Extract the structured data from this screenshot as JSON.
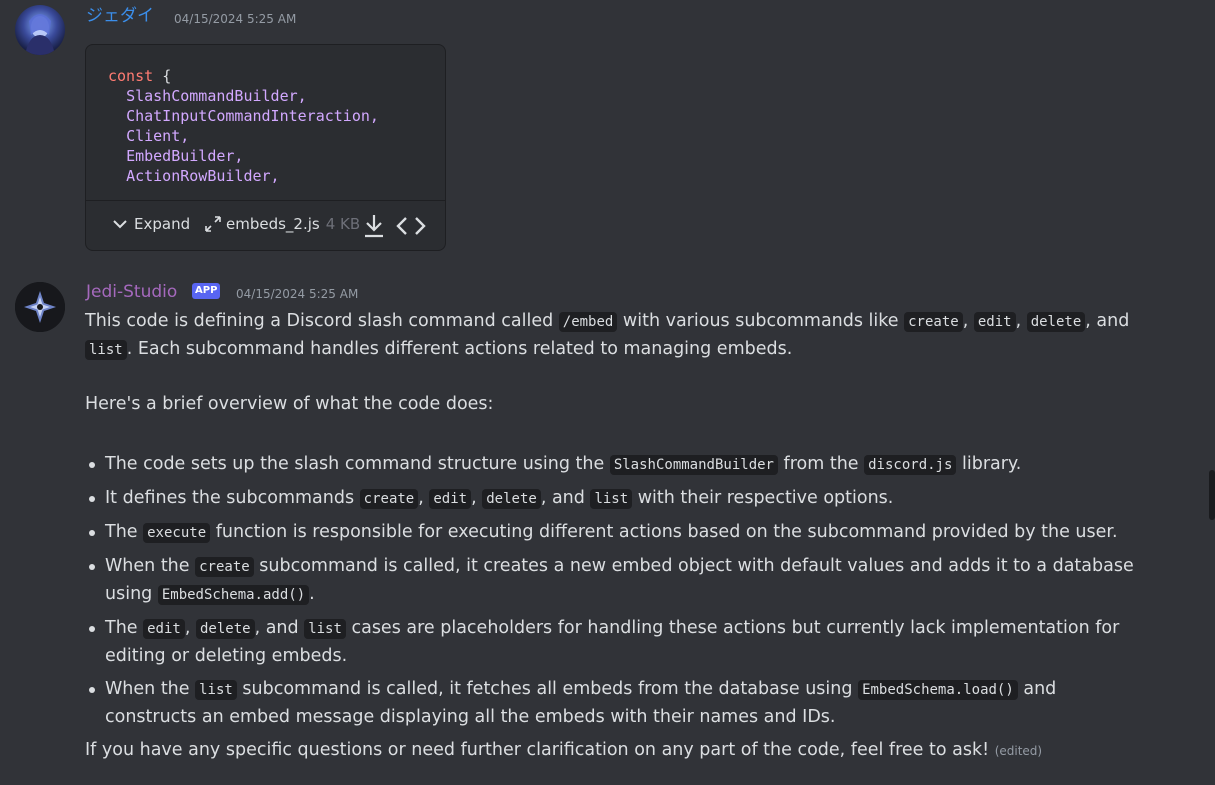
{
  "message1": {
    "username": "ジェダイ",
    "username_color": "#3b8eea",
    "timestamp": "04/15/2024 5:25 AM",
    "avatar": "anime-character-avatar",
    "attachment": {
      "code": {
        "keyword": "const",
        "open_brace": "{",
        "identifiers": [
          "SlashCommandBuilder,",
          "ChatInputCommandInteraction,",
          "Client,",
          "EmbedBuilder,",
          "ActionRowBuilder,"
        ]
      },
      "expand_label": "Expand",
      "filename": "embeds_2.js",
      "filesize": "4 KB",
      "icons": [
        "chevron-down-icon",
        "expand-arrows-icon",
        "download-icon",
        "code-icon"
      ]
    }
  },
  "message2": {
    "username": "Jedi-Studio",
    "username_color": "#a569bd",
    "badge": "APP",
    "timestamp": "04/15/2024 5:25 AM",
    "avatar": "jedi-studio-logo",
    "intro": {
      "t1": "This code is defining a Discord slash command called ",
      "c1": "/embed",
      "t2": " with various subcommands like ",
      "c2": "create",
      "t3": ", ",
      "c3": "edit",
      "t4": ", ",
      "c4": "delete",
      "t5": ", and ",
      "c5": "list",
      "t6": ". Each subcommand handles different actions related to managing embeds."
    },
    "overview": "Here's a brief overview of what the code does:",
    "bullets": {
      "b1": {
        "t1": "The code sets up the slash command structure using the ",
        "c1": "SlashCommandBuilder",
        "t2": " from the ",
        "c2": "discord.js",
        "t3": " library."
      },
      "b2": {
        "t1": "It defines the subcommands ",
        "c1": "create",
        "t2": ", ",
        "c2": "edit",
        "t3": ", ",
        "c3": "delete",
        "t4": ", and ",
        "c4": "list",
        "t5": " with their respective options."
      },
      "b3": {
        "t1": "The ",
        "c1": "execute",
        "t2": " function is responsible for executing different actions based on the subcommand provided by the user."
      },
      "b4": {
        "t1": "When the ",
        "c1": "create",
        "t2": " subcommand is called, it creates a new embed object with default values and adds it to a database using ",
        "c2": "EmbedSchema.add()",
        "t3": "."
      },
      "b5": {
        "t1": "The ",
        "c1": "edit",
        "t2": ", ",
        "c2": "delete",
        "t3": ", and ",
        "c3": "list",
        "t4": " cases are placeholders for handling these actions but currently lack implementation for editing or deleting embeds."
      },
      "b6": {
        "t1": "When the ",
        "c1": "list",
        "t2": " subcommand is called, it fetches all embeds from the database using ",
        "c2": "EmbedSchema.load()",
        "t3": " and constructs an embed message displaying all the embeds with their names and IDs."
      }
    },
    "closing": "If you have any specific questions or need further clarification on any part of the code, feel free to ask!",
    "edited": "(edited)"
  }
}
